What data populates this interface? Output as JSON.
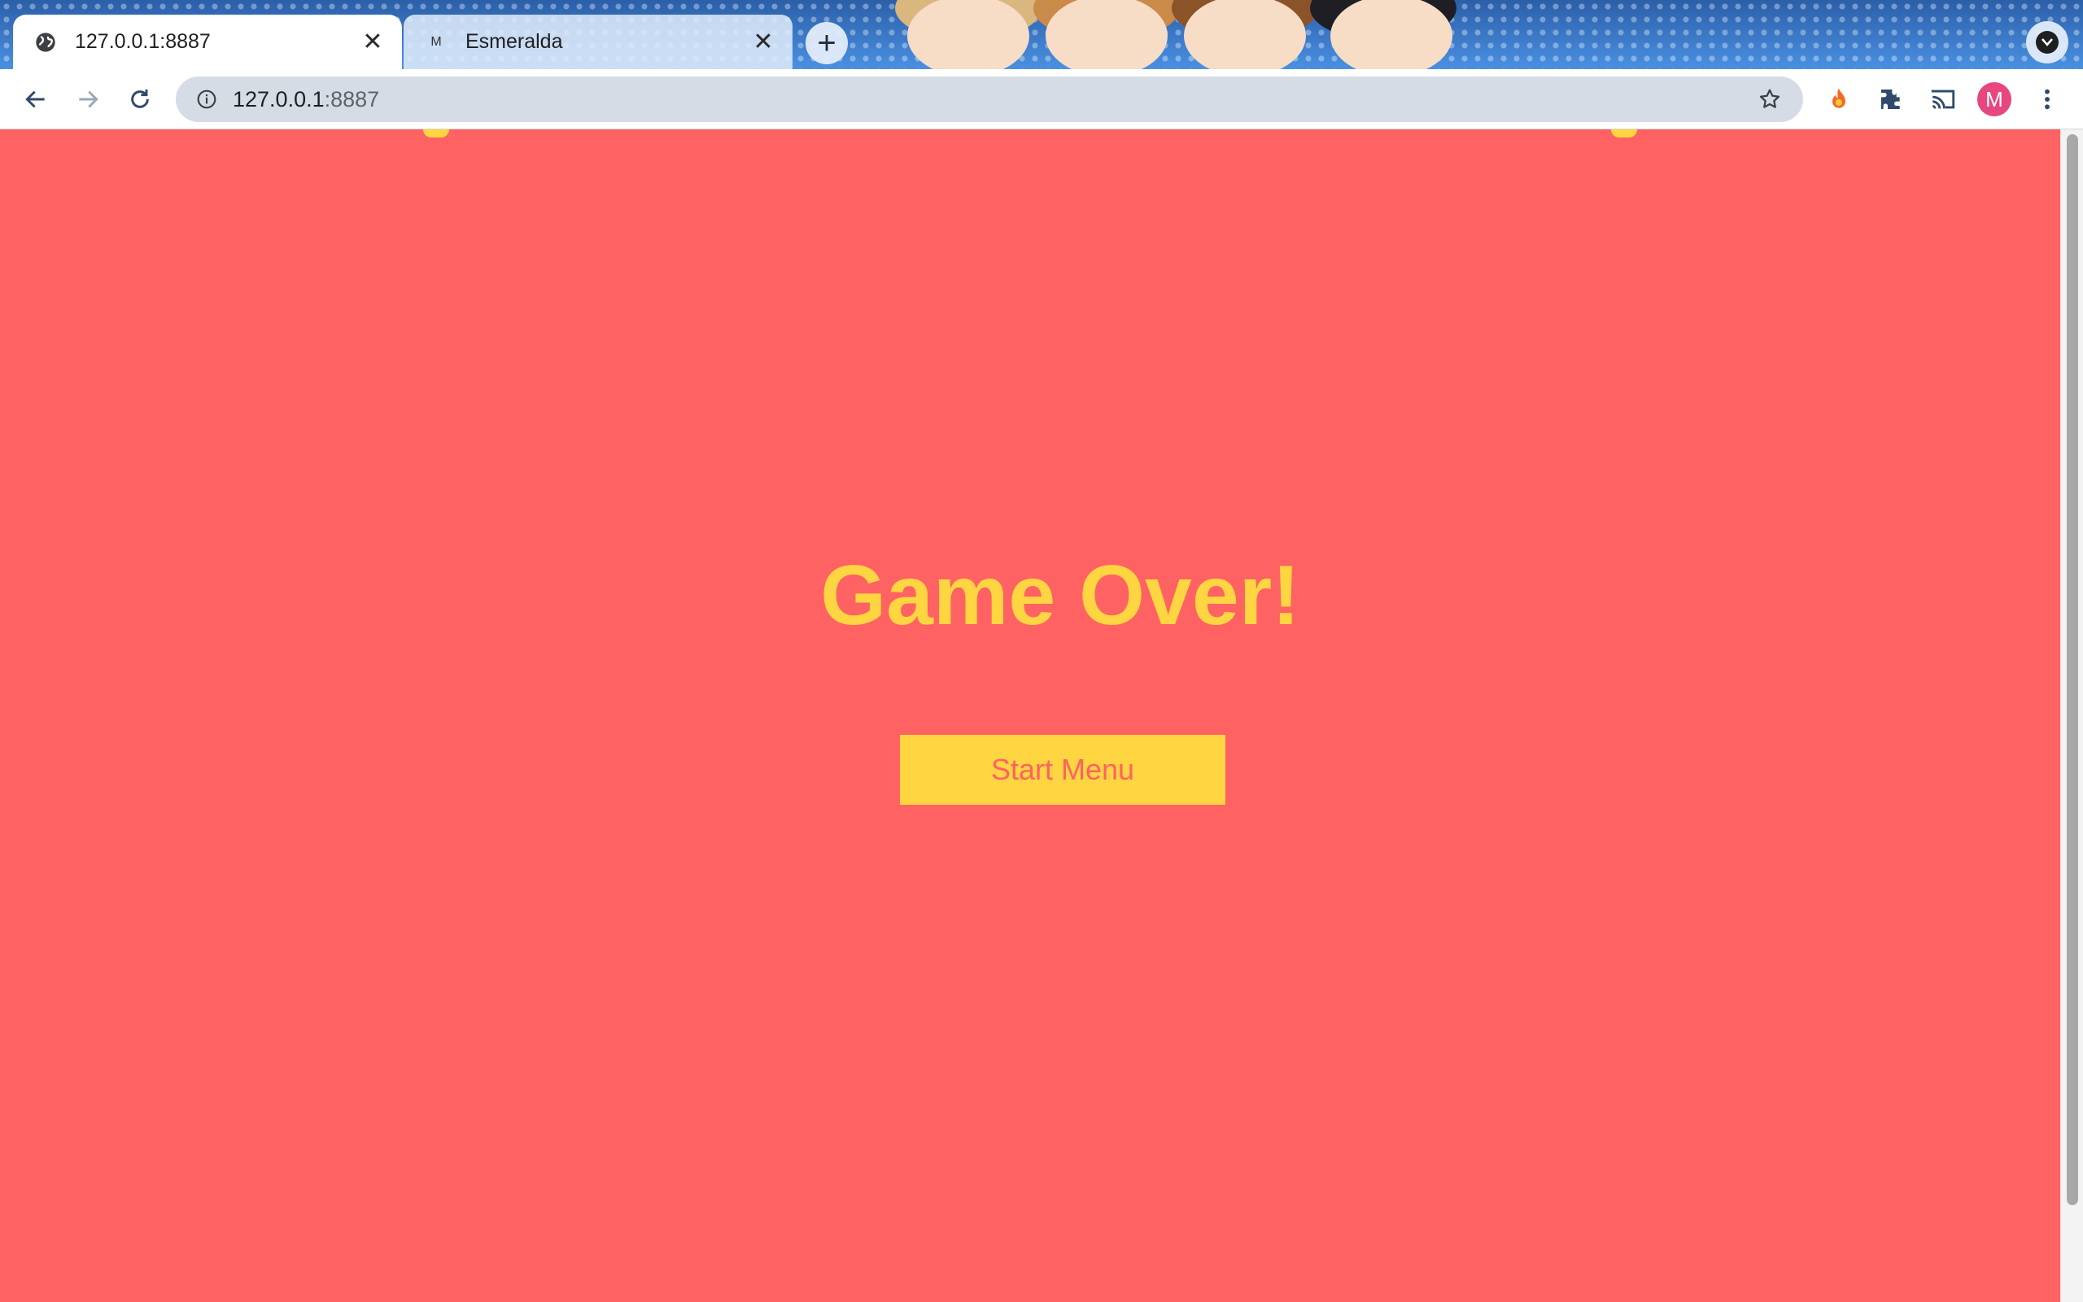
{
  "browser": {
    "tabs": [
      {
        "title": "127.0.0.1:8887",
        "favicon": "globe-icon",
        "active": true
      },
      {
        "title": "Esmeralda",
        "favicon": "M",
        "active": false
      }
    ],
    "new_tab_symbol": "+",
    "close_symbol": "✕",
    "address": {
      "host": "127.0.0.1",
      "port": ":8887"
    },
    "profile_initial": "M"
  },
  "icons": [
    "globe-icon",
    "close-icon",
    "plus-icon",
    "tab-search-icon",
    "back-arrow-icon",
    "forward-arrow-icon",
    "reload-icon",
    "info-icon",
    "star-icon",
    "flame-extension-icon",
    "puzzle-extensions-icon",
    "cast-icon",
    "more-vert-icon"
  ],
  "page": {
    "title": "Game Over!",
    "button_label": "Start Menu",
    "colors": {
      "background": "#ff6262",
      "accent": "#ffd541"
    }
  }
}
